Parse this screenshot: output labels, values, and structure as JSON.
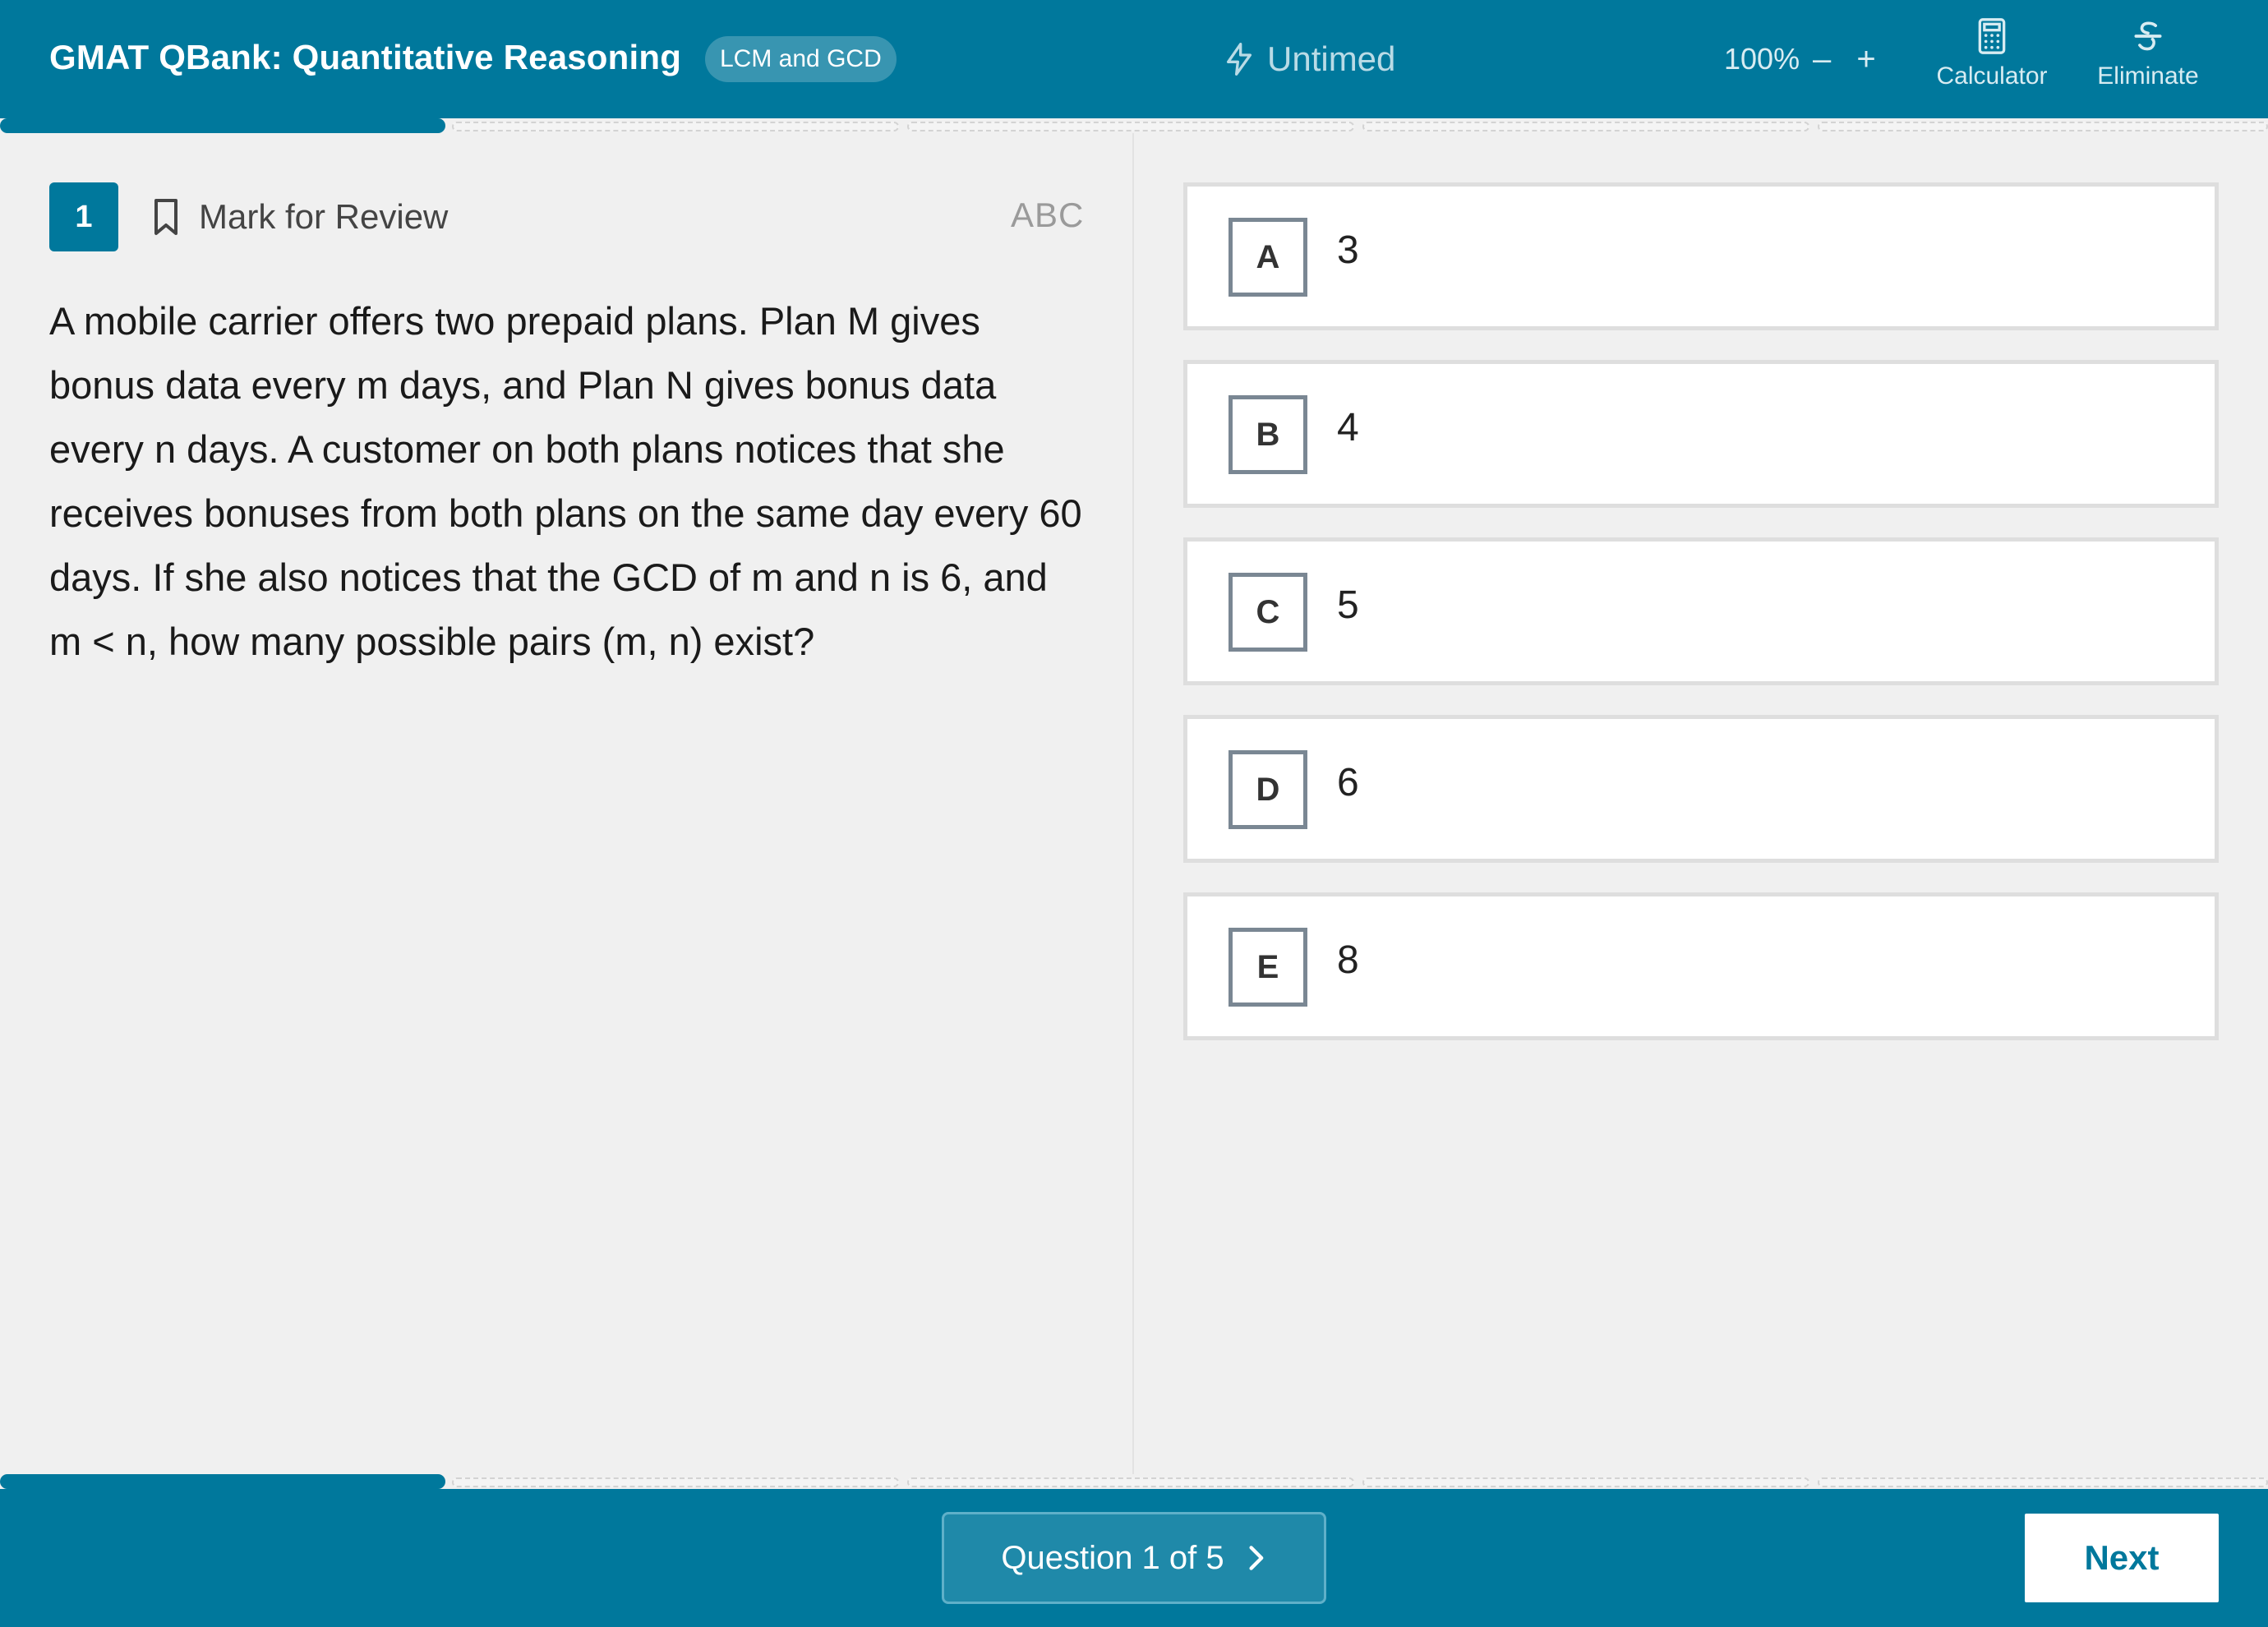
{
  "header": {
    "title": "GMAT QBank: Quantitative Reasoning",
    "topic": "LCM and GCD",
    "timer_label": "Untimed",
    "zoom_level": "100%",
    "zoom_out": "–",
    "zoom_in": "+",
    "tools": [
      {
        "label": "Calculator",
        "icon": "calculator-icon"
      },
      {
        "label": "Eliminate",
        "icon": "strikethrough-icon"
      }
    ]
  },
  "progress": {
    "total": 5,
    "current": 1
  },
  "question": {
    "number": "1",
    "mark_for_review": "Mark for Review",
    "abc_label": "ABC",
    "text": "A mobile carrier offers two prepaid plans. Plan M gives bonus data every m days, and Plan N gives bonus data every n days. A customer on both plans notices that she receives bonuses from both plans on the same day every 60 days. If she also notices that the GCD of m and n is 6, and m < n, how many possible pairs (m, n) exist?"
  },
  "options": [
    {
      "letter": "A",
      "text": "3"
    },
    {
      "letter": "B",
      "text": "4"
    },
    {
      "letter": "C",
      "text": "5"
    },
    {
      "letter": "D",
      "text": "6"
    },
    {
      "letter": "E",
      "text": "8"
    }
  ],
  "footer": {
    "nav_label": "Question 1 of 5",
    "next_label": "Next"
  },
  "colors": {
    "brand": "#00789c",
    "background": "#f0f0f0"
  }
}
